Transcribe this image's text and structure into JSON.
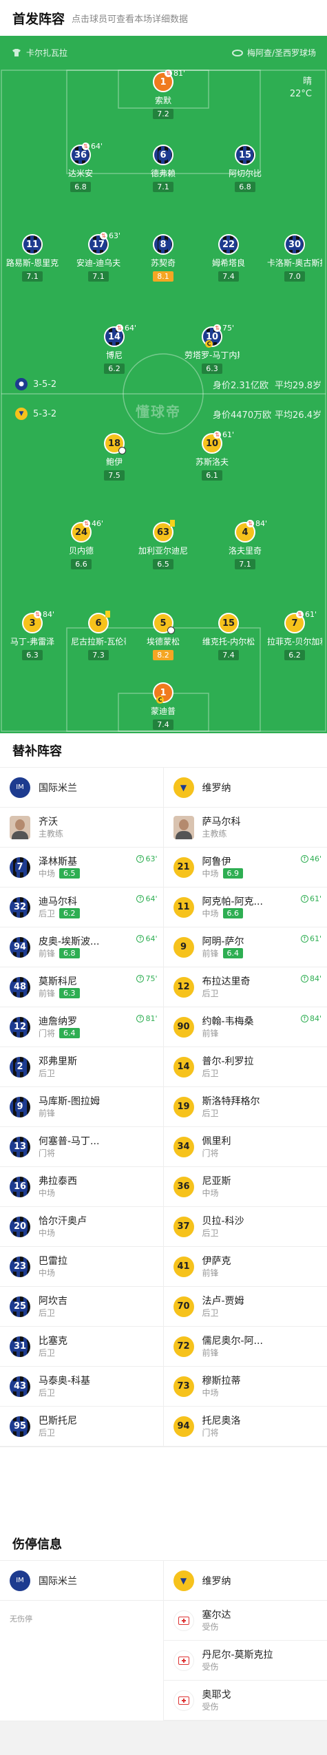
{
  "header": {
    "title": "首发阵容",
    "hint": "点击球员可查看本场详细数据"
  },
  "pitch": {
    "home_team": "卡尔扎瓦拉",
    "away_team": "梅阿查/圣西罗球场",
    "weather": "晴",
    "temperature": "22°C",
    "watermark": "懂球帝",
    "inter_formation": "3-5-2",
    "inter_value": "身价2.31亿欧",
    "inter_age": "平均29.8岁",
    "verona_formation": "5-3-2",
    "verona_value": "身价4470万欧",
    "verona_age": "平均26.4岁"
  },
  "lineup": {
    "p1": {
      "num": "1",
      "name": "索默",
      "rating": "7.2",
      "tag": "81'"
    },
    "p2": {
      "num": "36",
      "name": "达米安",
      "rating": "6.8",
      "tag": "64'"
    },
    "p3": {
      "num": "6",
      "name": "德弗赖",
      "rating": "7.1"
    },
    "p4": {
      "num": "15",
      "name": "阿切尔比",
      "rating": "6.8"
    },
    "p5": {
      "num": "11",
      "name": "路易斯-恩里克",
      "rating": "7.1"
    },
    "p6": {
      "num": "17",
      "name": "安迪-迪乌夫",
      "rating": "7.1",
      "tag": "63'"
    },
    "p7": {
      "num": "8",
      "name": "苏契奇",
      "rating": "8.1"
    },
    "p8": {
      "num": "22",
      "name": "姆希塔良",
      "rating": "7.4"
    },
    "p9": {
      "num": "30",
      "name": "卡洛斯-奥古斯托",
      "rating": "7.0"
    },
    "p10": {
      "num": "14",
      "name": "博尼",
      "rating": "6.2",
      "tag": "64'"
    },
    "p11": {
      "num": "10",
      "name": "劳塔罗-马丁内斯",
      "rating": "6.3",
      "tag": "75'"
    },
    "v1": {
      "num": "18",
      "name": "鲍伊",
      "rating": "7.5"
    },
    "v2": {
      "num": "10",
      "name": "苏斯洛夫",
      "rating": "6.1",
      "tag": "61'"
    },
    "v3": {
      "num": "24",
      "name": "贝内德",
      "rating": "6.6",
      "tag": "46'"
    },
    "v4": {
      "num": "63",
      "name": "加利亚尔迪尼",
      "rating": "6.5"
    },
    "v5": {
      "num": "4",
      "name": "洛夫里奇",
      "rating": "7.1",
      "tag": "84'"
    },
    "v6": {
      "num": "3",
      "name": "马丁-弗雷泽",
      "rating": "6.3",
      "tag": "84'"
    },
    "v7": {
      "num": "6",
      "name": "尼古拉斯-瓦伦蒂尼",
      "rating": "7.3"
    },
    "v8": {
      "num": "5",
      "name": "埃德蒙松",
      "rating": "8.2"
    },
    "v9": {
      "num": "15",
      "name": "维克托-内尔松",
      "rating": "7.4"
    },
    "v10": {
      "num": "7",
      "name": "拉菲克-贝尔加利",
      "rating": "6.2",
      "tag": "61'"
    },
    "v11": {
      "num": "1",
      "name": "蒙迪普",
      "rating": "7.4"
    }
  },
  "subs": {
    "title": "替补阵容",
    "left_team": "国际米兰",
    "right_team": "维罗纳",
    "left_coach": {
      "name": "齐沃",
      "role": "主教练"
    },
    "right_coach": {
      "name": "萨马尔科",
      "role": "主教练"
    },
    "left": [
      {
        "num": "7",
        "name": "泽林斯基",
        "pos": "中场",
        "rating": "6.5",
        "min": "63'"
      },
      {
        "num": "32",
        "name": "迪马尔科",
        "pos": "后卫",
        "rating": "6.2",
        "min": "64'"
      },
      {
        "num": "94",
        "name": "皮奥-埃斯波...",
        "pos": "前锋",
        "rating": "6.8",
        "min": "64'"
      },
      {
        "num": "48",
        "name": "莫斯科尼",
        "pos": "前锋",
        "rating": "6.3",
        "min": "75'"
      },
      {
        "num": "12",
        "name": "迪詹纳罗",
        "pos": "门将",
        "rating": "6.4",
        "min": "81'"
      },
      {
        "num": "2",
        "name": "邓弗里斯",
        "pos": "后卫"
      },
      {
        "num": "9",
        "name": "马库斯-图拉姆",
        "pos": "前锋"
      },
      {
        "num": "13",
        "name": "何塞普-马丁...",
        "pos": "门将"
      },
      {
        "num": "16",
        "name": "弗拉泰西",
        "pos": "中场"
      },
      {
        "num": "20",
        "name": "恰尔汗奥卢",
        "pos": "中场"
      },
      {
        "num": "23",
        "name": "巴雷拉",
        "pos": "中场"
      },
      {
        "num": "25",
        "name": "阿坎吉",
        "pos": "后卫"
      },
      {
        "num": "31",
        "name": "比塞克",
        "pos": "后卫"
      },
      {
        "num": "43",
        "name": "马泰奥-科基",
        "pos": "后卫"
      },
      {
        "num": "95",
        "name": "巴斯托尼",
        "pos": "后卫"
      }
    ],
    "right": [
      {
        "num": "21",
        "name": "阿鲁伊",
        "pos": "中场",
        "rating": "6.9",
        "min": "46'"
      },
      {
        "num": "11",
        "name": "阿克帕-阿克...",
        "pos": "中场",
        "rating": "6.6",
        "min": "61'"
      },
      {
        "num": "9",
        "name": "阿明-萨尔",
        "pos": "前锋",
        "rating": "6.4",
        "min": "61'"
      },
      {
        "num": "12",
        "name": "布拉达里奇",
        "pos": "后卫",
        "min": "84'"
      },
      {
        "num": "90",
        "name": "约翰-韦梅桑",
        "pos": "前锋",
        "min": "84'"
      },
      {
        "num": "14",
        "name": "普尔-利罗拉",
        "pos": "后卫"
      },
      {
        "num": "19",
        "name": "斯洛特拜格尔",
        "pos": "后卫"
      },
      {
        "num": "34",
        "name": "佩里利",
        "pos": "门将"
      },
      {
        "num": "36",
        "name": "尼亚斯",
        "pos": "中场"
      },
      {
        "num": "37",
        "name": "贝拉-科沙",
        "pos": "后卫"
      },
      {
        "num": "41",
        "name": "伊萨克",
        "pos": "前锋"
      },
      {
        "num": "70",
        "name": "法卢-贾姆",
        "pos": "后卫"
      },
      {
        "num": "72",
        "name": "儒尼奥尔-阿...",
        "pos": "前锋"
      },
      {
        "num": "73",
        "name": "穆斯拉蒂",
        "pos": "中场"
      },
      {
        "num": "94",
        "name": "托尼奥洛",
        "pos": "门将"
      }
    ]
  },
  "injuries": {
    "title": "伤停信息",
    "left_team": "国际米兰",
    "right_team": "维罗纳",
    "left_empty": "无伤停",
    "right": [
      {
        "name": "塞尔达",
        "status": "受伤"
      },
      {
        "name": "丹尼尔-莫斯克拉",
        "status": "受伤"
      },
      {
        "name": "奥耶戈",
        "status": "受伤"
      }
    ]
  },
  "colors": {
    "pitch": "#2eae52",
    "inter": "#1d3b8f",
    "verona": "#f6c21c",
    "gk": "#f07b1e",
    "rating_high": "#f5a623"
  }
}
